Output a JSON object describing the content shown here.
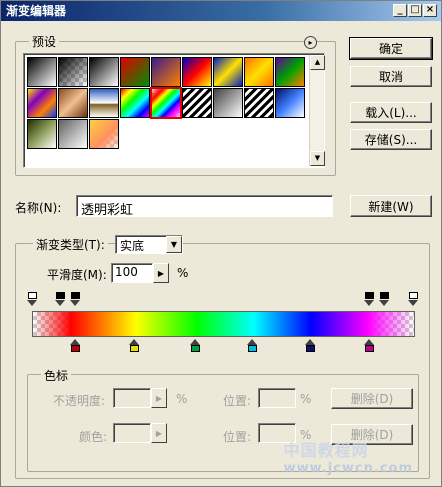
{
  "window": {
    "title": "渐变编辑器",
    "min_label": "_",
    "max_label": "□",
    "close_label": "×"
  },
  "presets": {
    "label": "预设",
    "menu_icon": "circle-arrow-icon",
    "swatches": [
      {
        "name": "foreground-to-background",
        "bg": "linear-gradient(135deg,#000,#fff)"
      },
      {
        "name": "foreground-to-transparent",
        "bg": "linear-gradient(135deg,#000 0%,rgba(0,0,0,0) 100%)",
        "checker": true
      },
      {
        "name": "black-white",
        "bg": "linear-gradient(135deg,#000,#fff)"
      },
      {
        "name": "red-green",
        "bg": "linear-gradient(135deg,#e00000,#009000)"
      },
      {
        "name": "violet-orange",
        "bg": "linear-gradient(135deg,#3a1a8a,#ff8000)"
      },
      {
        "name": "blue-red-yellow",
        "bg": "linear-gradient(135deg,#0000c0,#ff0000,#ffff00)"
      },
      {
        "name": "blue-yellow-blue",
        "bg": "linear-gradient(135deg,#0020c0,#ffe000,#0020c0)"
      },
      {
        "name": "orange-yellow-orange",
        "bg": "linear-gradient(135deg,#ff7000,#ffe000,#ff7000)"
      },
      {
        "name": "violet-green-orange",
        "bg": "linear-gradient(135deg,#6000a0,#00a000,#ff8000)"
      },
      {
        "name": "yellow-violet-orange-blue",
        "bg": "linear-gradient(135deg,#ffe000,#8000c0,#ff8000,#0040ff)"
      },
      {
        "name": "copper",
        "bg": "linear-gradient(135deg,#8a4a20,#f0c090,#6a3010)"
      },
      {
        "name": "chrome",
        "bg": "linear-gradient(180deg,#3060c0,#ffffff 50%,#806020 55%,#ffffff)"
      },
      {
        "name": "spectrum",
        "bg": "linear-gradient(135deg,#ff0000,#ffff00,#00ff00,#00ffff,#0000ff,#ff00ff)"
      },
      {
        "name": "transparent-rainbow",
        "bg": "linear-gradient(135deg,rgba(255,0,0,0.2),#ff0000 20%,#ffff00,#00ff00,#00ffff,#0000ff,#ff00ff 80%,rgba(255,0,255,0.2))",
        "checker": true,
        "selected": true
      },
      {
        "name": "transparent-stripes",
        "bg": "repeating-linear-gradient(135deg,#000 0,#000 3px,#fff 3px,#fff 6px)"
      },
      {
        "name": "black-white-2",
        "bg": "linear-gradient(135deg,#404040,#ffffff)"
      },
      {
        "name": "stripes-2",
        "bg": "repeating-linear-gradient(135deg,#000 0,#000 3px,#fff 3px,#fff 6px)"
      },
      {
        "name": "blue-white",
        "bg": "linear-gradient(135deg,#001060,#4080ff,#ffffff)"
      },
      {
        "name": "green-white",
        "bg": "linear-gradient(135deg,#203000,#90a060,#ffffff)"
      },
      {
        "name": "gray-white",
        "bg": "linear-gradient(135deg,#606060,#ffffff)",
        "checker": true
      },
      {
        "name": "orange-transparent",
        "bg": "linear-gradient(135deg,#ffd040,#ff9060 60%,rgba(255,160,100,0.1))",
        "checker": true
      }
    ]
  },
  "buttons": {
    "ok": "确定",
    "cancel": "取消",
    "load": "载入(L)...",
    "save": "存储(S)...",
    "new": "新建(W)",
    "delete_opacity": "删除(D)",
    "delete_color": "删除(D)"
  },
  "name_field": {
    "label": "名称(N):",
    "value": "透明彩虹"
  },
  "gradient": {
    "type_label": "渐变类型(T):",
    "type_value": "实底",
    "smoothness_label": "平滑度(M):",
    "smoothness_value": "100",
    "smoothness_unit": "%",
    "bar_bg": "linear-gradient(to right, rgba(255,0,0,0) 0%, #ff0000 10%, #ffff00 27%, #00ff00 43%, #00ffff 58%, #0000ff 73%, #ff00ff 88%, rgba(255,0,255,0) 100%)",
    "opacity_stops": [
      {
        "position": 0.0,
        "color": "#ffffff"
      },
      {
        "position": 0.075,
        "color": "#000000"
      },
      {
        "position": 0.115,
        "color": "#000000"
      },
      {
        "position": 0.885,
        "color": "#000000"
      },
      {
        "position": 0.925,
        "color": "#000000"
      },
      {
        "position": 1.0,
        "color": "#ffffff"
      }
    ],
    "color_stops": [
      {
        "position": 0.115,
        "color": "#c00000"
      },
      {
        "position": 0.27,
        "color": "#e8e000"
      },
      {
        "position": 0.43,
        "color": "#00a040"
      },
      {
        "position": 0.58,
        "color": "#00c0e0"
      },
      {
        "position": 0.73,
        "color": "#10106a"
      },
      {
        "position": 0.885,
        "color": "#c00090"
      }
    ]
  },
  "stops_panel": {
    "label": "色标",
    "opacity_label": "不透明度:",
    "opacity_unit": "%",
    "location_label_1": "位置:",
    "location_unit_1": "%",
    "color_label": "颜色:",
    "location_label_2": "位置:",
    "location_unit_2": "%"
  },
  "watermark": {
    "line1": "中国教程网",
    "line2": "www.jcwcn.com"
  }
}
